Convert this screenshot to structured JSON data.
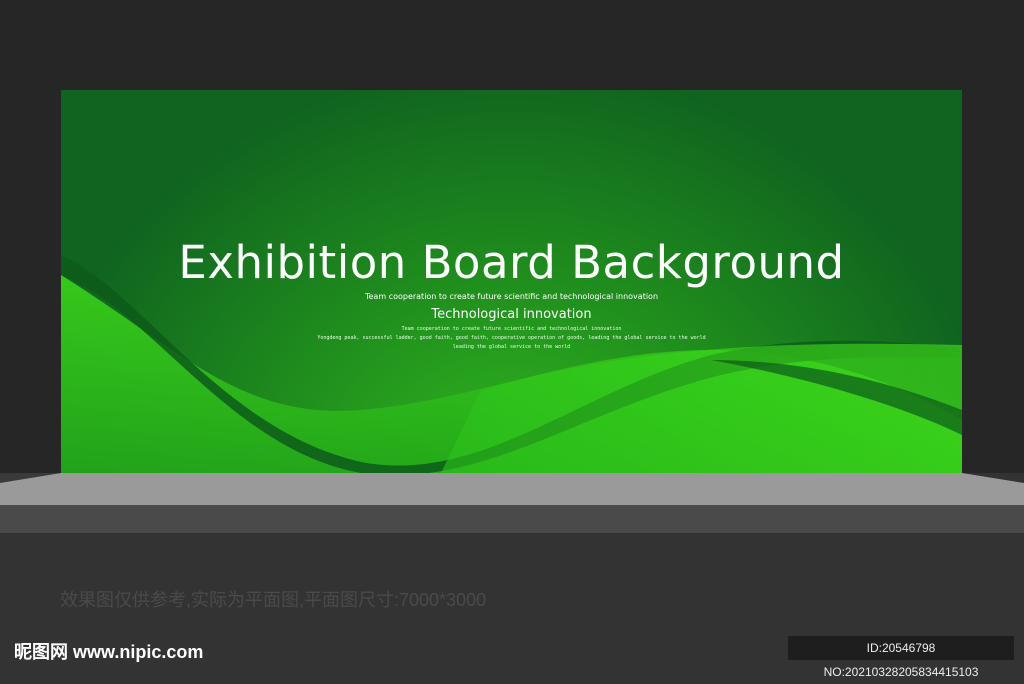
{
  "board": {
    "title": "Exhibition Board Background",
    "subtitle_small": "Team cooperation to create future scientific and technological innovation",
    "subtitle": "Technological innovation",
    "lines": [
      "Team cooperation to create future scientific and technological innovation",
      "Yongdeng peak, successful ladder, good faith, good faith, cooperative operation of goods, leading the global service to the world",
      "leading the global service to the world"
    ],
    "colors": {
      "dark_green": "#10641f",
      "bright_green": "#3de01a"
    }
  },
  "note": "效果图仅供参考,实际为平面图,平面图尺寸:7000*3000",
  "watermark": {
    "logo": "昵图网 www.nipic.com",
    "id": "ID:20546798 NO:20210328205834415103"
  }
}
